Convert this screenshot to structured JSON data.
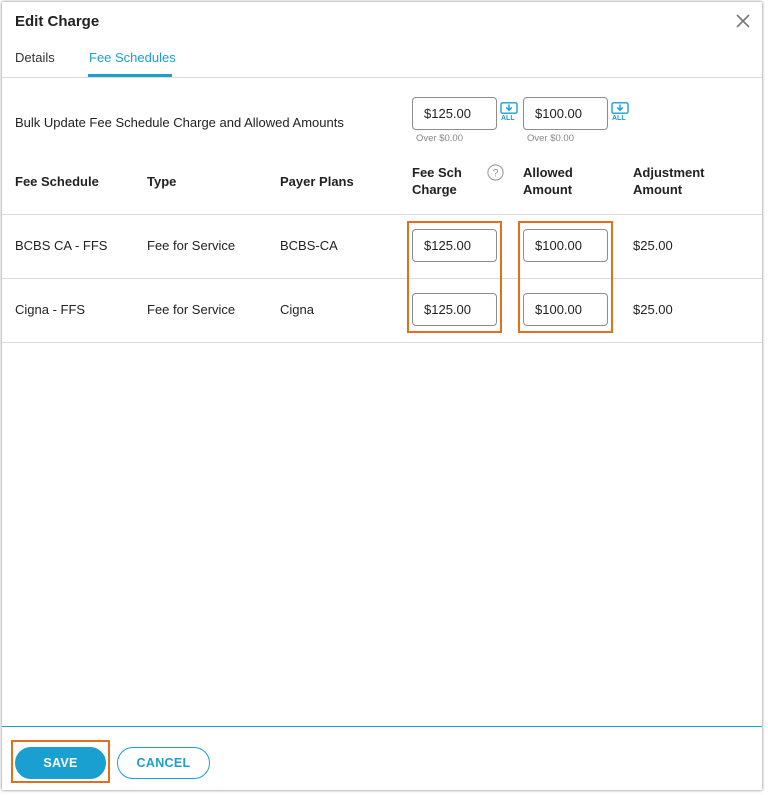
{
  "dialog": {
    "title": "Edit Charge"
  },
  "tabs": [
    {
      "label": "Details",
      "active": false
    },
    {
      "label": "Fee Schedules",
      "active": true
    }
  ],
  "bulk": {
    "label": "Bulk Update Fee Schedule Charge and Allowed Amounts",
    "charge_value": "$125.00",
    "charge_hint": "Over $0.00",
    "allowed_value": "$100.00",
    "allowed_hint": "Over $0.00",
    "apply_all_label": "ALL"
  },
  "table": {
    "headers": {
      "fee_schedule": "Fee Schedule",
      "type": "Type",
      "payer_plans": "Payer Plans",
      "fee_sch_charge_line1": "Fee Sch",
      "fee_sch_charge_line2": "Charge",
      "allowed_line1": "Allowed",
      "allowed_line2": "Amount",
      "adjustment_line1": "Adjustment",
      "adjustment_line2": "Amount"
    },
    "rows": [
      {
        "fee_schedule": "BCBS CA - FFS",
        "type": "Fee for Service",
        "payer_plans": "BCBS-CA",
        "charge": "$125.00",
        "allowed": "$100.00",
        "adjustment": "$25.00"
      },
      {
        "fee_schedule": "Cigna - FFS",
        "type": "Fee for Service",
        "payer_plans": "Cigna",
        "charge": "$125.00",
        "allowed": "$100.00",
        "adjustment": "$25.00"
      }
    ]
  },
  "footer": {
    "save_label": "SAVE",
    "cancel_label": "CANCEL"
  },
  "colors": {
    "accent": "#1a9fd1",
    "highlight": "#e0701e"
  }
}
